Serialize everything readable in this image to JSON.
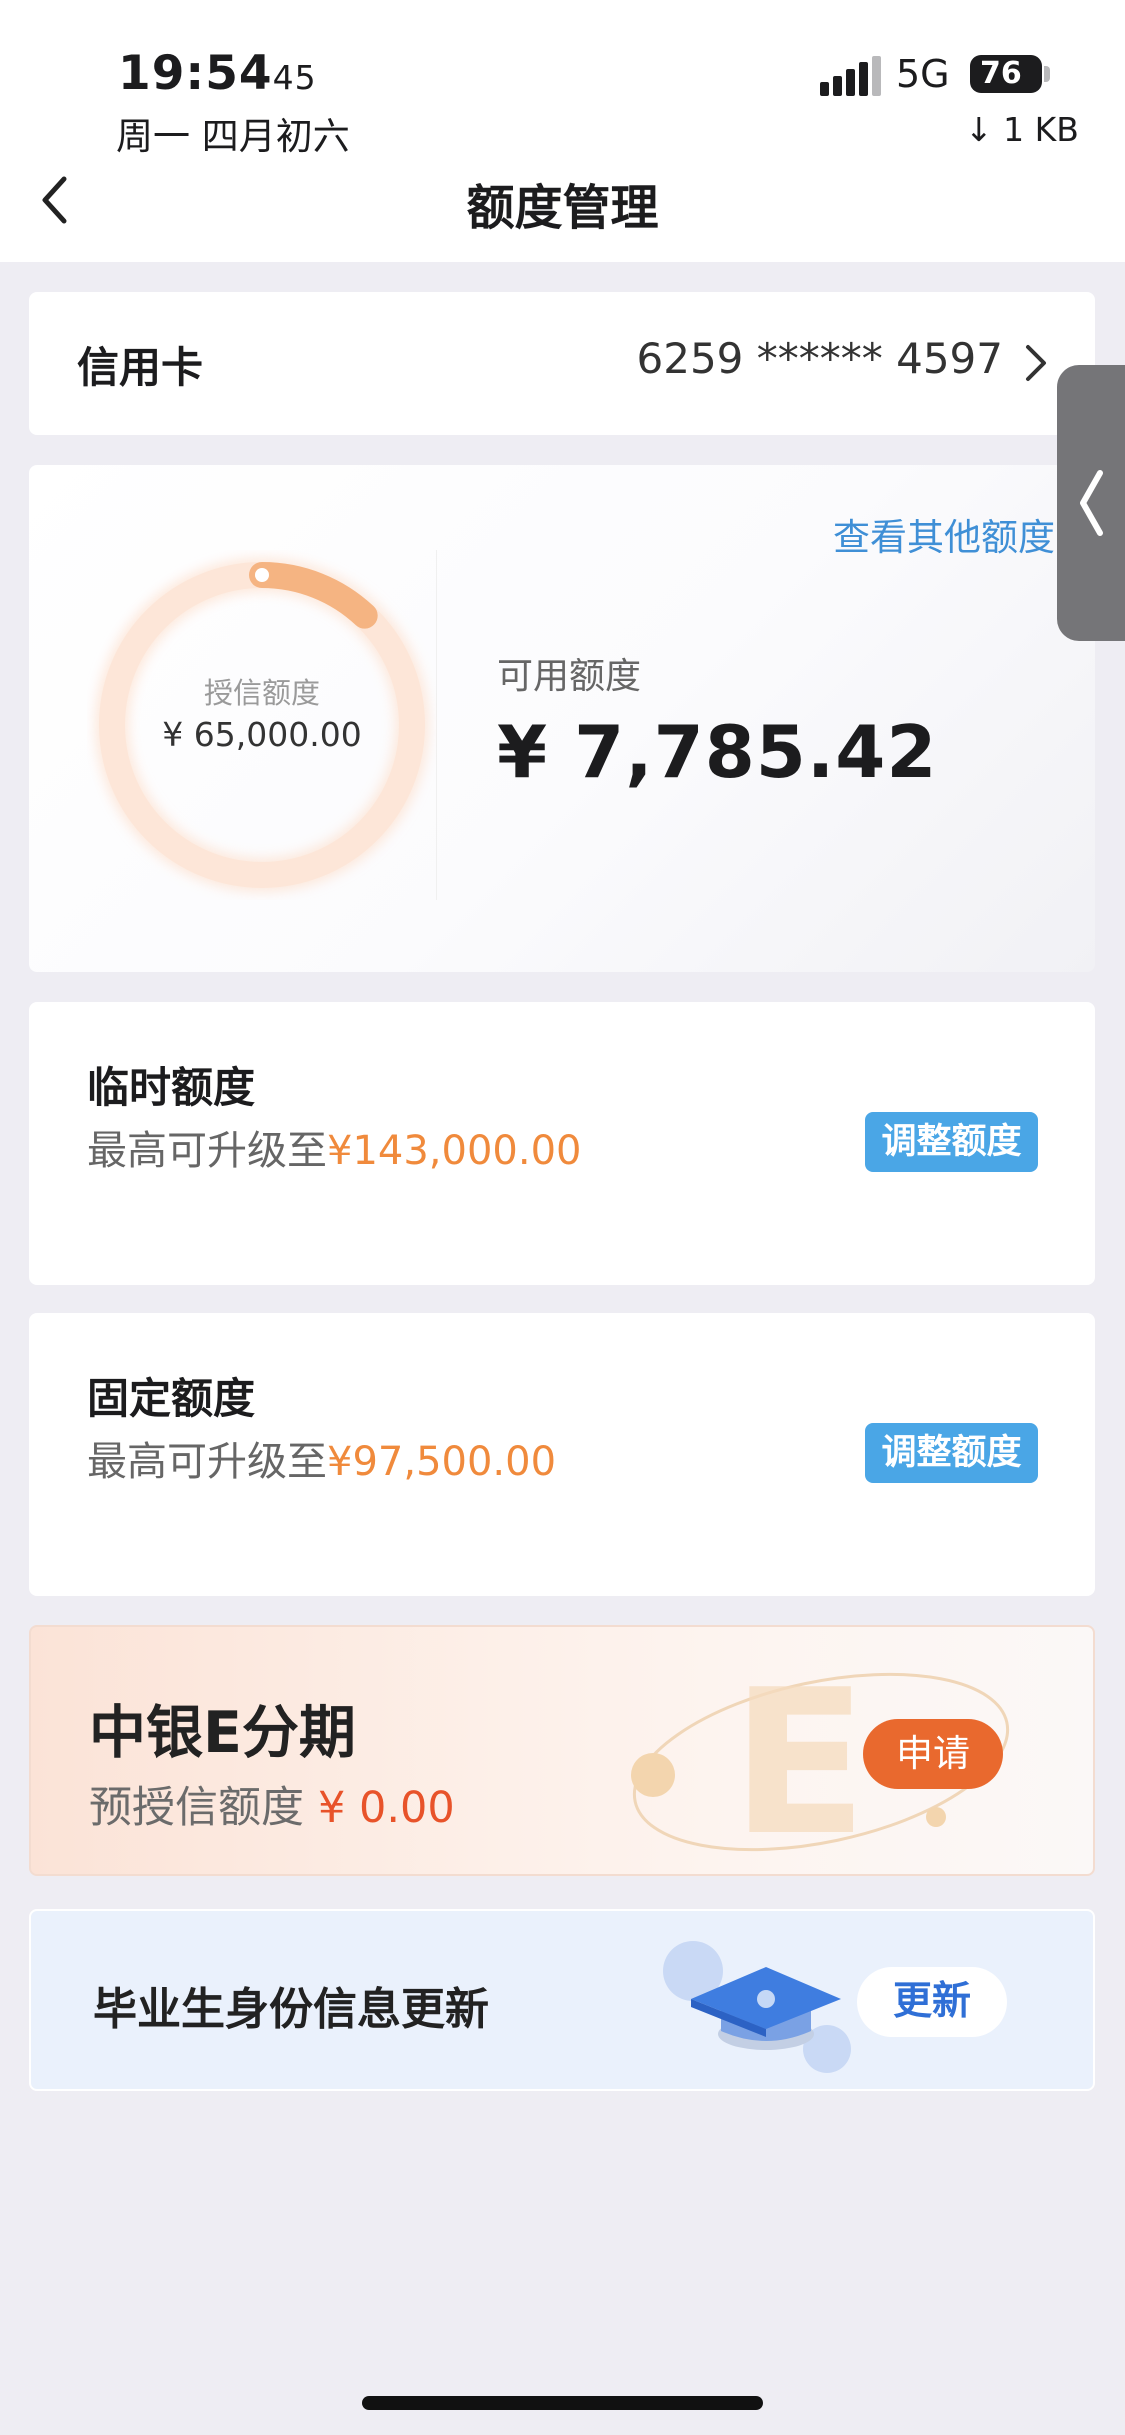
{
  "status_bar": {
    "time": "19:54",
    "seconds": "45",
    "date": "周一 四月初六",
    "network": "5G",
    "battery": "76",
    "speed": "↓ 1 KB"
  },
  "header": {
    "title": "额度管理",
    "back_icon": "chevron-left-icon"
  },
  "account": {
    "label": "信用卡",
    "number": "6259 ****** 4597"
  },
  "credit": {
    "other_link": "查看其他额度",
    "ring_label": "授信额度",
    "ring_value": "¥ 65,000.00",
    "available_label": "可用额度",
    "available_value": "¥ 7,785.42",
    "used_fraction": 0.12,
    "ring_color": "#f5b482"
  },
  "temp_limit": {
    "title": "临时额度",
    "desc_prefix": "最高可升级至",
    "amount": "¥143,000.00",
    "button": "调整额度"
  },
  "fixed_limit": {
    "title": "固定额度",
    "desc_prefix": "最高可升级至",
    "amount": "¥97,500.00",
    "button": "调整额度"
  },
  "installment": {
    "title": "中银E分期",
    "desc_prefix": "预授信额度",
    "amount": "¥ 0.00",
    "button": "申请"
  },
  "graduate": {
    "title": "毕业生身份信息更新",
    "button": "更新"
  },
  "colors": {
    "accent_blue": "#4aa6e6",
    "link_blue": "#3f8fd6",
    "orange": "#f08a3c",
    "apply_orange": "#e9692e"
  }
}
